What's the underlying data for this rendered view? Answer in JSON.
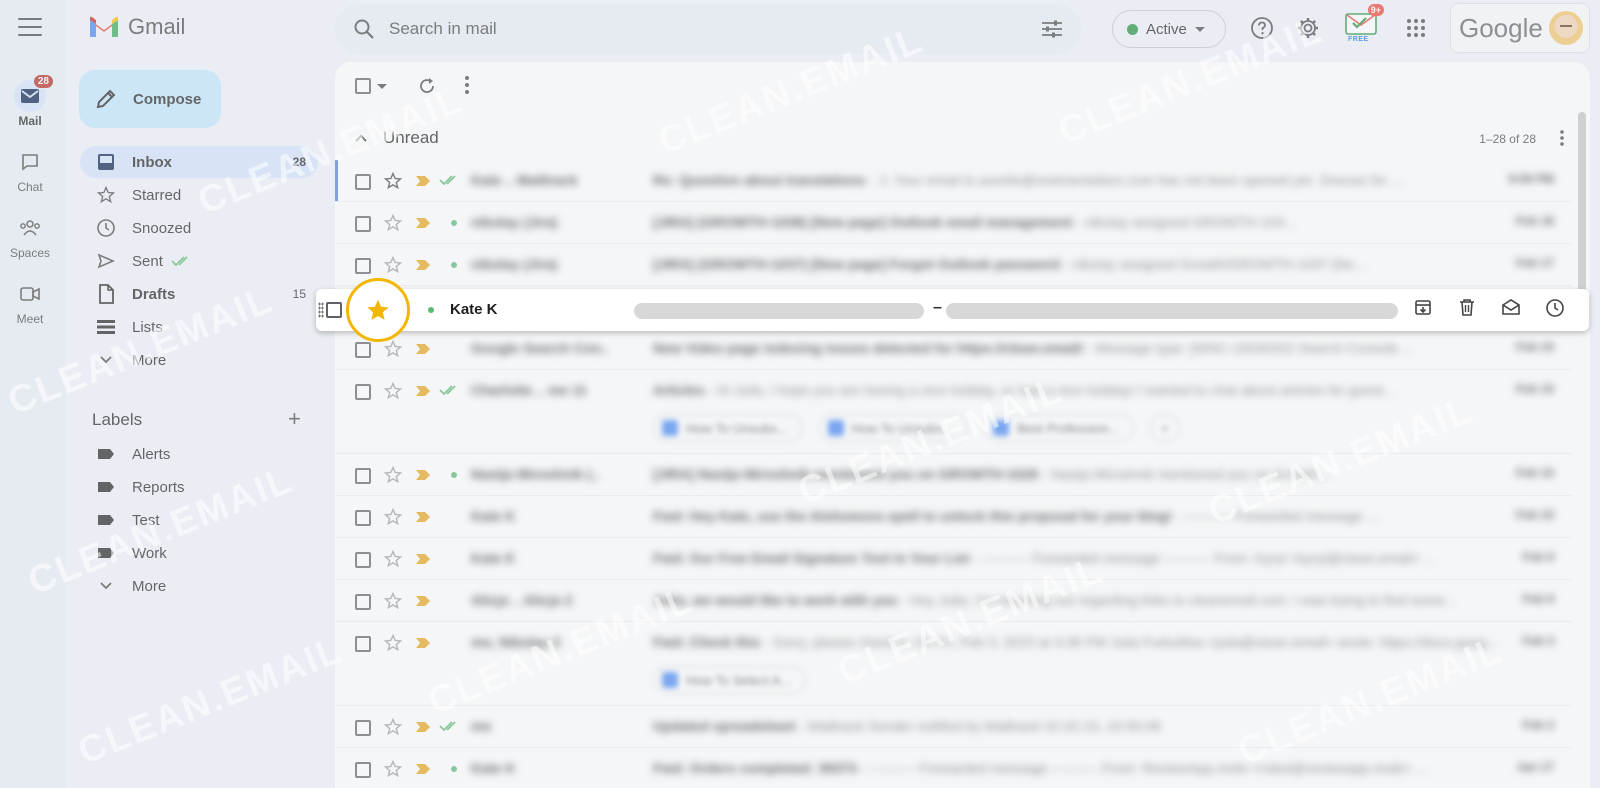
{
  "app": {
    "logo_text": "Gmail"
  },
  "rail": {
    "mail": {
      "label": "Mail",
      "badge": "28"
    },
    "chat": {
      "label": "Chat"
    },
    "spaces": {
      "label": "Spaces"
    },
    "meet": {
      "label": "Meet"
    }
  },
  "compose_label": "Compose",
  "nav": {
    "inbox": {
      "label": "Inbox",
      "count": "28"
    },
    "starred": {
      "label": "Starred"
    },
    "snoozed": {
      "label": "Snoozed"
    },
    "sent": {
      "label": "Sent"
    },
    "drafts": {
      "label": "Drafts",
      "count": "15"
    },
    "lists": {
      "label": "Lists"
    },
    "more": {
      "label": "More"
    }
  },
  "labels": {
    "heading": "Labels",
    "items": [
      "Alerts",
      "Reports",
      "Test",
      "Work"
    ],
    "more": "More"
  },
  "search": {
    "placeholder": "Search in mail"
  },
  "status": {
    "label": "Active",
    "color": "#1e8e3e"
  },
  "extension": {
    "badge": "9+",
    "tag": "FREE"
  },
  "account": {
    "wordmark": "Google"
  },
  "section": {
    "title": "Unread",
    "pager": "1–28 of 28"
  },
  "hover_row": {
    "sender": "Kate K",
    "separator": "–"
  },
  "watermark": "CLEAN.EMAIL",
  "colors": {
    "accent": "#d3e3fd",
    "compose": "#c2e7ff",
    "star": "#f2b705",
    "important": "#e8a317"
  },
  "rows": [
    {
      "sender": "Kate .. Mailtrack",
      "subject": "Re: Question about translations",
      "snippet": " - ⚠ Your email to aurelie@onetranslation.com has not been opened yet. Snooze for ...",
      "date": "9:09 PM",
      "tall": false
    },
    {
      "sender": "nikolay (Jira)",
      "subject": "[JIRA] (GROWTH-1038) [New page] Outlook email management",
      "snippet": " - nikolay assigned GROWTH-103...",
      "date": "Feb 18",
      "tall": false
    },
    {
      "sender": "nikolay (Jira)",
      "subject": "[JIRA] (GROWTH-1037) [New page] Forgot Outlook password",
      "snippet": " - nikolay assigned Growth/GROWTH-1037 [Ne...",
      "date": "Feb 17",
      "tall": false
    },
    {
      "sender": "",
      "subject": "",
      "snippet": "",
      "date": "",
      "tall": false,
      "hover": true
    },
    {
      "sender": "Google Search Con..",
      "subject": "New Video page indexing issues detected for https://clean.email/",
      "snippet": " - Message type: [WNC-10030322 Search Console ...",
      "date": "Feb 15",
      "tall": false
    },
    {
      "sender": "Charlotte .. me 11",
      "subject": "Articles",
      "snippet": " - Hi Julia, I hope you are having a nice holiday, or had a nice holiday! I wanted to chat about articles for guest...",
      "date": "Feb 15",
      "tall": true,
      "chips": [
        "How To Unsubs...",
        "How To Unsubs...",
        "Best Profession..."
      ]
    },
    {
      "sender": "Nastja Miroshnik (..",
      "subject": "[JIRA] Nastja Miroshnik mentioned you on GROWTH-1029",
      "snippet": " - Nastja Miroshnik mentioned you on Growth...",
      "date": "Feb 10",
      "tall": false
    },
    {
      "sender": "Kate K",
      "subject": "Fwd: Hey Kate, use the Alohomora spell to unlock this proposal for your blog!",
      "snippet": " - ---------- Forwarded message ...",
      "date": "Feb 10",
      "tall": false
    },
    {
      "sender": "Kate K",
      "subject": "Fwd: Our Free Email Signature Tool in Your List",
      "snippet": " - ---------- Forwarded message ---------- From: Kyryl <kyryl@clean.email> ...",
      "date": "Feb 9",
      "tall": false
    },
    {
      "sender": "Alicja .. Alicja 2",
      "subject": "Julia, we would like to work with you",
      "snippet": " - Hey Julia, I'm reaching out regarding links to cleanemail.com. I was trying to find some...",
      "date": "Feb 8",
      "tall": false
    },
    {
      "sender": "me, Nikolay 2",
      "subject": "Fwd: Check this",
      "snippet": " - Sorry, please check it. On Fri, Feb 3, 2023 at 4:36 PM Julia Furkulitsa <julia@clean.email> wrote: https://docs.goog...",
      "date": "Feb 3",
      "tall": true,
      "chips": [
        "How To Select A..."
      ]
    },
    {
      "sender": "me",
      "subject": "Updated spreadsheet",
      "snippet": " - Mailtrack Sender notified by Mailtrack 02.02.23, 15:50:06",
      "date": "Feb 2",
      "tall": false
    },
    {
      "sender": "Kate K",
      "subject": "Fwd: Orders completed: 39373",
      "snippet": " - ---------- Forwarded message ---------- From: ReviewApp.mobi <robot@reviewapp.mobi> ...",
      "date": "Jan 17",
      "tall": false
    }
  ]
}
